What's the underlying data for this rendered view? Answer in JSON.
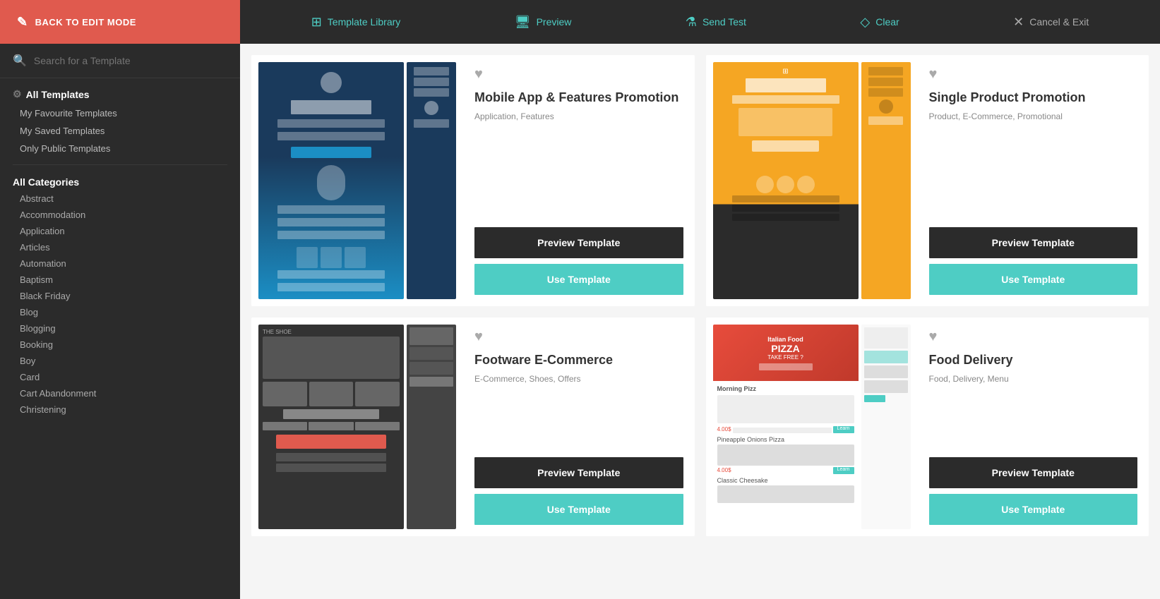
{
  "nav": {
    "back_label": "BACK TO EDIT MODE",
    "items": [
      {
        "id": "template-library",
        "label": "Template Library",
        "icon": "🗂"
      },
      {
        "id": "preview",
        "label": "Preview",
        "icon": "🖥"
      },
      {
        "id": "send-test",
        "label": "Send Test",
        "icon": "🧪"
      },
      {
        "id": "clear",
        "label": "Clear",
        "icon": "🗑"
      },
      {
        "id": "cancel-exit",
        "label": "Cancel & Exit",
        "icon": "✕",
        "danger": true
      }
    ]
  },
  "sidebar": {
    "search_placeholder": "Search for a Template",
    "main_items": [
      {
        "id": "all-templates",
        "label": "All Templates",
        "active": true
      },
      {
        "id": "favourites",
        "label": "My Favourite Templates"
      },
      {
        "id": "saved",
        "label": "My Saved Templates"
      },
      {
        "id": "public",
        "label": "Only Public Templates"
      }
    ],
    "categories_title": "All Categories",
    "categories": [
      "Abstract",
      "Accommodation",
      "Application",
      "Articles",
      "Automation",
      "Baptism",
      "Black Friday",
      "Blog",
      "Blogging",
      "Booking",
      "Boy",
      "Card",
      "Cart Abandonment",
      "Christening"
    ]
  },
  "templates": [
    {
      "id": "mobile-app",
      "title": "Mobile App & Features Promotion",
      "tags": "Application, Features",
      "favourite": false,
      "preview_label": "Preview Template",
      "use_label": "Use Template",
      "mock_type": "mobile"
    },
    {
      "id": "single-product",
      "title": "Single Product Promotion",
      "tags": "Product, E-Commerce, Promotional",
      "favourite": false,
      "preview_label": "Preview Template",
      "use_label": "Use Template",
      "mock_type": "product"
    },
    {
      "id": "footware",
      "title": "Footware E-Commerce",
      "tags": "E-Commerce, Shoes, Offers",
      "favourite": false,
      "preview_label": "Preview Template",
      "use_label": "Use Template",
      "mock_type": "footware"
    },
    {
      "id": "food-delivery",
      "title": "Food Delivery",
      "tags": "Food, Delivery, Menu",
      "favourite": false,
      "preview_label": "Preview Template",
      "use_label": "Use Template",
      "mock_type": "food"
    }
  ],
  "buttons": {
    "preview_label": "Preview Template",
    "use_label": "Use Template",
    "clear_label": "Clear",
    "cancel_label": "Cancel & Exit"
  }
}
